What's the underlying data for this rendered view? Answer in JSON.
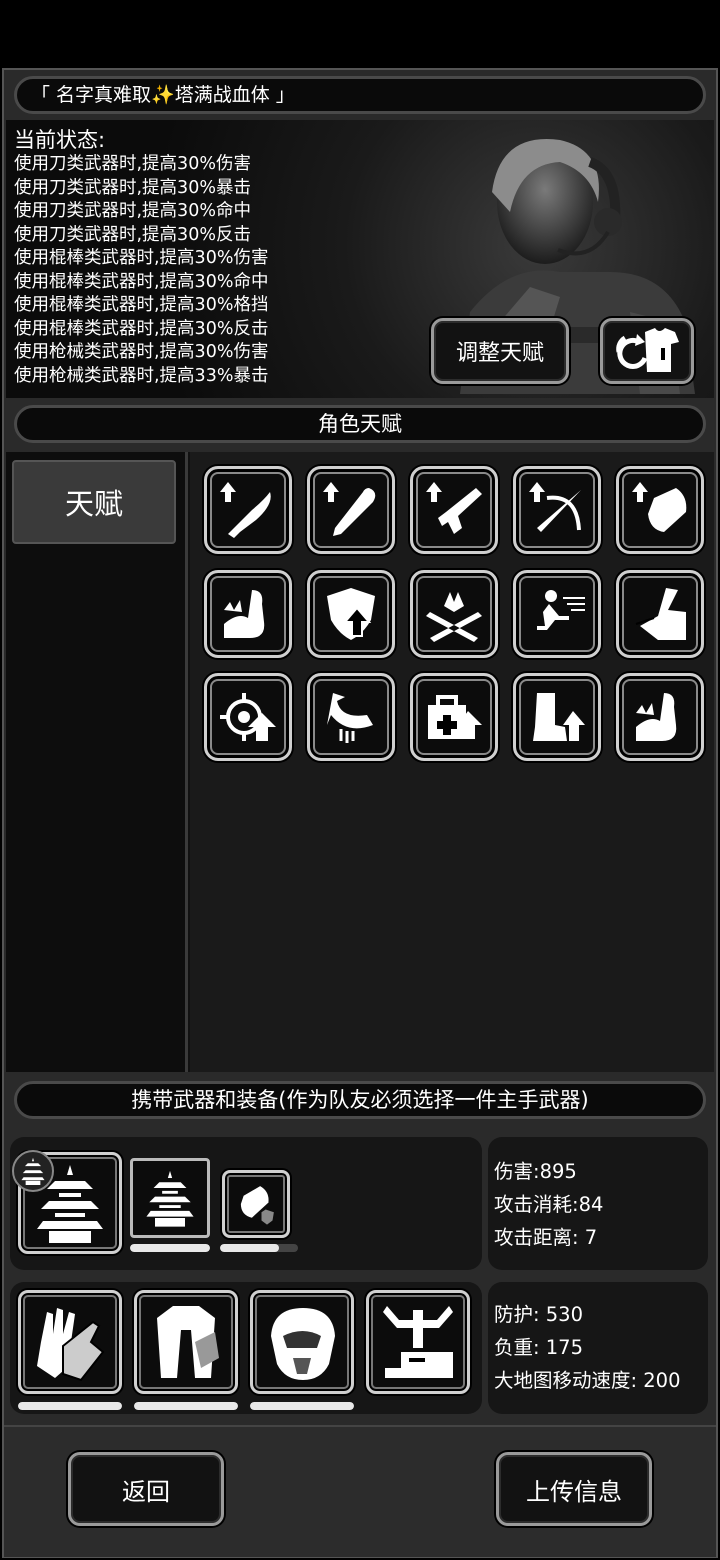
{
  "header": {
    "player_name": "「 名字真难取✨塔满战血体 」"
  },
  "status": {
    "title": "当前状态:",
    "lines": [
      "使用刀类武器时,提高30%伤害",
      "使用刀类武器时,提高30%暴击",
      "使用刀类武器时,提高30%命中",
      "使用刀类武器时,提高30%反击",
      "使用棍棒类武器时,提高30%伤害",
      "使用棍棒类武器时,提高30%命中",
      "使用棍棒类武器时,提高30%格挡",
      "使用棍棒类武器时,提高30%反击",
      "使用枪械类武器时,提高30%伤害",
      "使用枪械类武器时,提高33%暴击"
    ],
    "adjust_label": "调整天赋"
  },
  "talents": {
    "section_title": "角色天赋",
    "tab_label": "天赋",
    "icons": [
      "blade-up-icon",
      "bat-up-icon",
      "pistol-up-icon",
      "crossbow-up-icon",
      "gauntlet-up-icon",
      "strength-flex-icon",
      "shield-up-icon",
      "parry-icon",
      "dodge-run-icon",
      "counter-arm-icon",
      "target-up-icon",
      "grab-arm-icon",
      "medkit-up-icon",
      "boot-up-icon",
      "strength-flex-icon-2"
    ]
  },
  "equipment": {
    "section_title": "携带武器和装备(作为队友必须选择一件主手武器)",
    "weapon_stats": [
      "伤害:895",
      "攻击消耗:84",
      "攻击距离: 7"
    ],
    "armor_stats": [
      "防护: 530",
      "负重: 175",
      "大地图移动速度: 200"
    ],
    "weapon_durability": [
      1.0,
      0.75
    ],
    "armor_durability": [
      1.0,
      1.0,
      1.0
    ]
  },
  "footer": {
    "back_label": "返回",
    "upload_label": "上传信息"
  }
}
